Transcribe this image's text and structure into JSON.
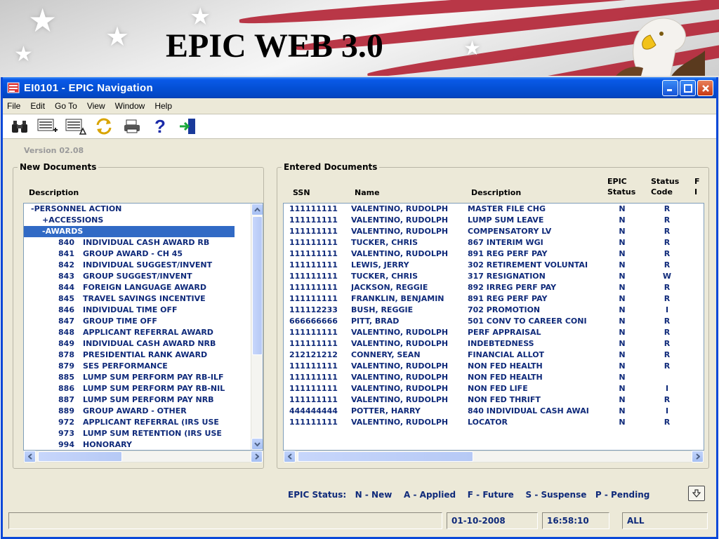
{
  "slide_title": "EPIC WEB 3.0",
  "window": {
    "title": "EI0101 - EPIC Navigation"
  },
  "menu": [
    "File",
    "Edit",
    "Go To",
    "View",
    "Window",
    "Help"
  ],
  "toolbar_icons": [
    "binoculars-icon",
    "add-document-icon",
    "edit-document-icon",
    "refresh-icon",
    "print-icon",
    "help-icon",
    "exit-icon"
  ],
  "version": "Version  02.08",
  "new_documents": {
    "label": "New Documents",
    "column": "Description",
    "items": [
      {
        "text": "-PERSONNEL ACTION",
        "indent": 0,
        "selected": false
      },
      {
        "text": "+ACCESSIONS",
        "indent": 1,
        "selected": false
      },
      {
        "text": "-AWARDS",
        "indent": 1,
        "selected": true
      },
      {
        "code": "840",
        "text": "INDIVIDUAL CASH AWARD RB",
        "indent": 2
      },
      {
        "code": "841",
        "text": "GROUP AWARD - CH 45",
        "indent": 2
      },
      {
        "code": "842",
        "text": "INDIVIDUAL SUGGEST/INVENT",
        "indent": 2
      },
      {
        "code": "843",
        "text": "GROUP SUGGEST/INVENT",
        "indent": 2
      },
      {
        "code": "844",
        "text": "FOREIGN LANGUAGE AWARD",
        "indent": 2
      },
      {
        "code": "845",
        "text": "TRAVEL SAVINGS INCENTIVE",
        "indent": 2
      },
      {
        "code": "846",
        "text": "INDIVIDUAL TIME OFF",
        "indent": 2
      },
      {
        "code": "847",
        "text": "GROUP TIME OFF",
        "indent": 2
      },
      {
        "code": "848",
        "text": "APPLICANT REFERRAL AWARD",
        "indent": 2
      },
      {
        "code": "849",
        "text": "INDIVIDUAL CASH AWARD NRB",
        "indent": 2
      },
      {
        "code": "878",
        "text": "PRESIDENTIAL RANK AWARD",
        "indent": 2
      },
      {
        "code": "879",
        "text": "SES PERFORMANCE",
        "indent": 2
      },
      {
        "code": "885",
        "text": "LUMP SUM PERFORM PAY RB-ILF",
        "indent": 2
      },
      {
        "code": "886",
        "text": "LUMP SUM PERFORM PAY RB-NIL",
        "indent": 2
      },
      {
        "code": "887",
        "text": "LUMP SUM PERFORM PAY NRB",
        "indent": 2
      },
      {
        "code": "889",
        "text": "GROUP AWARD - OTHER",
        "indent": 2
      },
      {
        "code": "972",
        "text": "APPLICANT REFERRAL (IRS USE",
        "indent": 2
      },
      {
        "code": "973",
        "text": "LUMP SUM RETENTION (IRS USE",
        "indent": 2
      },
      {
        "code": "994",
        "text": "HONORARY",
        "indent": 2
      }
    ]
  },
  "entered_documents": {
    "label": "Entered Documents",
    "columns": {
      "ssn": "SSN",
      "name": "Name",
      "description": "Description",
      "epic_status": "EPIC\nStatus",
      "status_code": "Status\nCode",
      "extra": "F\nI"
    },
    "rows": [
      {
        "ssn": "111111111",
        "name": "VALENTINO, RUDOLPH",
        "desc": "MASTER FILE CHG",
        "epic": "N",
        "code": "R"
      },
      {
        "ssn": "111111111",
        "name": "VALENTINO, RUDOLPH",
        "desc": "LUMP SUM LEAVE",
        "epic": "N",
        "code": "R"
      },
      {
        "ssn": "111111111",
        "name": "VALENTINO, RUDOLPH",
        "desc": "COMPENSATORY LV",
        "epic": "N",
        "code": "R"
      },
      {
        "ssn": "111111111",
        "name": "TUCKER, CHRIS",
        "desc": "867 INTERIM WGI",
        "epic": "N",
        "code": "R"
      },
      {
        "ssn": "111111111",
        "name": "VALENTINO, RUDOLPH",
        "desc": "891 REG PERF PAY",
        "epic": "N",
        "code": "R"
      },
      {
        "ssn": "111111111",
        "name": "LEWIS, JERRY",
        "desc": "302 RETIREMENT VOLUNTAI",
        "epic": "N",
        "code": "R"
      },
      {
        "ssn": "111111111",
        "name": "TUCKER, CHRIS",
        "desc": "317 RESIGNATION",
        "epic": "N",
        "code": "W"
      },
      {
        "ssn": "111111111",
        "name": "JACKSON, REGGIE",
        "desc": "892 IRREG PERF PAY",
        "epic": "N",
        "code": "R"
      },
      {
        "ssn": "111111111",
        "name": "FRANKLIN, BENJAMIN",
        "desc": "891 REG PERF PAY",
        "epic": "N",
        "code": "R"
      },
      {
        "ssn": "111112233",
        "name": "BUSH, REGGIE",
        "desc": "702 PROMOTION",
        "epic": "N",
        "code": "I"
      },
      {
        "ssn": "666666666",
        "name": "PITT, BRAD",
        "desc": "501 CONV TO CAREER CONI",
        "epic": "N",
        "code": "R"
      },
      {
        "ssn": "111111111",
        "name": "VALENTINO, RUDOLPH",
        "desc": "PERF APPRAISAL",
        "epic": "N",
        "code": "R"
      },
      {
        "ssn": "111111111",
        "name": "VALENTINO, RUDOLPH",
        "desc": "INDEBTEDNESS",
        "epic": "N",
        "code": "R"
      },
      {
        "ssn": "212121212",
        "name": "CONNERY, SEAN",
        "desc": "FINANCIAL ALLOT",
        "epic": "N",
        "code": "R"
      },
      {
        "ssn": "111111111",
        "name": "VALENTINO, RUDOLPH",
        "desc": "NON FED HEALTH",
        "epic": "N",
        "code": "R"
      },
      {
        "ssn": "111111111",
        "name": "VALENTINO, RUDOLPH",
        "desc": "NON FED HEALTH",
        "epic": "N",
        "code": ""
      },
      {
        "ssn": "111111111",
        "name": "VALENTINO, RUDOLPH",
        "desc": "NON FED LIFE",
        "epic": "N",
        "code": "I"
      },
      {
        "ssn": "111111111",
        "name": "VALENTINO, RUDOLPH",
        "desc": "NON FED THRIFT",
        "epic": "N",
        "code": "R"
      },
      {
        "ssn": "444444444",
        "name": "POTTER, HARRY",
        "desc": "840 INDIVIDUAL CASH AWAI",
        "epic": "N",
        "code": "I"
      },
      {
        "ssn": "111111111",
        "name": "VALENTINO, RUDOLPH",
        "desc": "LOCATOR",
        "epic": "N",
        "code": "R"
      }
    ]
  },
  "epic_status_legend": "EPIC Status:   N - New    A - Applied    F - Future    S - Suspense   P - Pending",
  "statusbar": {
    "message": "",
    "date": "01-10-2008",
    "time": "16:58:10",
    "filter": "ALL"
  },
  "colors": {
    "xp_blue": "#0450d6",
    "list_text": "#0f2a7a",
    "selection": "#316ac5",
    "face": "#ece9d8"
  }
}
